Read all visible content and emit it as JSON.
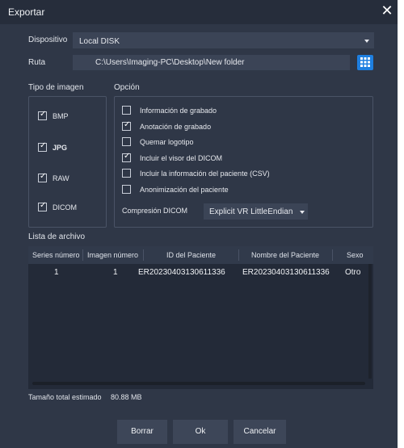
{
  "window": {
    "title": "Exportar"
  },
  "device": {
    "label": "Dispositivo",
    "value": "Local DISK"
  },
  "route": {
    "label": "Ruta",
    "value": "C:\\Users\\Imaging-PC\\Desktop\\New folder"
  },
  "image_type": {
    "title": "Tipo de imagen",
    "items": [
      {
        "label": "BMP",
        "checked": true
      },
      {
        "label": "JPG",
        "checked": true
      },
      {
        "label": "RAW",
        "checked": true
      },
      {
        "label": "DICOM",
        "checked": true
      }
    ]
  },
  "options": {
    "title": "Opción",
    "items": [
      {
        "label": "Información de grabado",
        "checked": false
      },
      {
        "label": "Anotación de grabado",
        "checked": true
      },
      {
        "label": "Quemar logotipo",
        "checked": false
      },
      {
        "label": "Incluir el visor del DICOM",
        "checked": true
      },
      {
        "label": "Incluir la información del paciente (CSV)",
        "checked": false
      },
      {
        "label": "Anonimización del paciente",
        "checked": false
      }
    ],
    "compression_label": "Compresión DICOM",
    "compression_value": "Explicit VR LittleEndian"
  },
  "file_list": {
    "title": "Lista de archivo",
    "columns": [
      "Series número",
      "Imagen número",
      "ID del Paciente",
      "Nombre del Paciente",
      "Sexo"
    ],
    "rows": [
      [
        "1",
        "1",
        "ER20230403130611336",
        "ER20230403130611336",
        "Otro"
      ]
    ]
  },
  "total": {
    "label": "Tamaño total estimado",
    "value": "80.88 MB"
  },
  "buttons": {
    "clear": "Borrar",
    "ok": "Ok",
    "cancel": "Cancelar"
  },
  "colors": {
    "accent": "#1e7fe0",
    "background": "#2f3747",
    "titlebar": "#262d3b"
  },
  "icons": {
    "close": "close-icon",
    "browse": "grid-icon",
    "dropdown": "chevron-down-icon",
    "check": "check-icon"
  }
}
